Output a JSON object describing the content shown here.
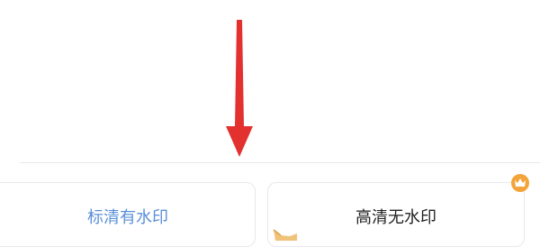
{
  "options": {
    "sd_label": "标清有水印",
    "hd_label": "高清无水印"
  },
  "icons": {
    "arrow": "arrow-down-icon",
    "crown": "crown-icon",
    "hand": "pointing-hand-icon"
  },
  "colors": {
    "arrow": "#e2312f",
    "sd_text": "#5a8fd8",
    "hd_text": "#222222",
    "badge": "#f3a43a",
    "card_border": "#e8e8ee"
  }
}
